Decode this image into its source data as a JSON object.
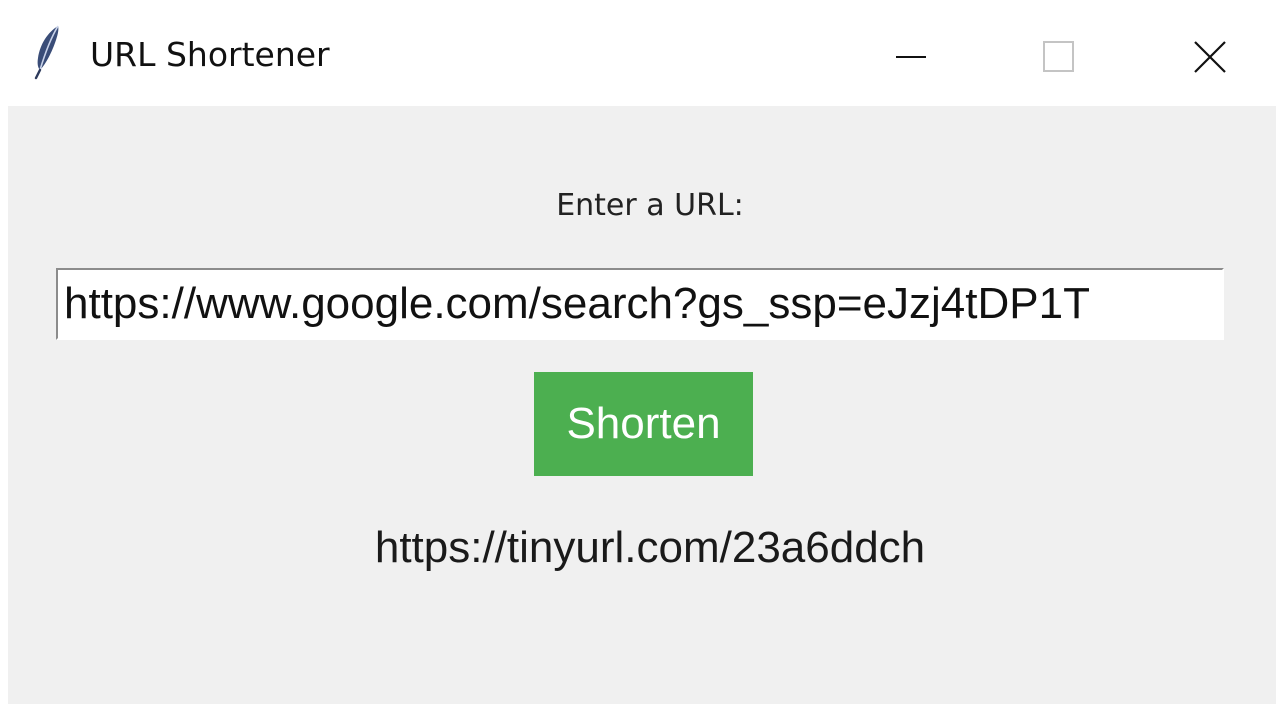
{
  "window": {
    "title": "URL Shortener",
    "icon": "feather-icon",
    "controls": {
      "minimize": "minimize-icon",
      "maximize": "maximize-icon",
      "close": "close-icon"
    }
  },
  "form": {
    "prompt": "Enter a URL:",
    "url_value": "https://www.google.com/search?gs_ssp=eJzj4tDP1T",
    "shorten_label": "Shorten",
    "result": "https://tinyurl.com/23a6ddch"
  },
  "colors": {
    "button_bg": "#4caf50",
    "client_bg": "#f0f0f0"
  }
}
